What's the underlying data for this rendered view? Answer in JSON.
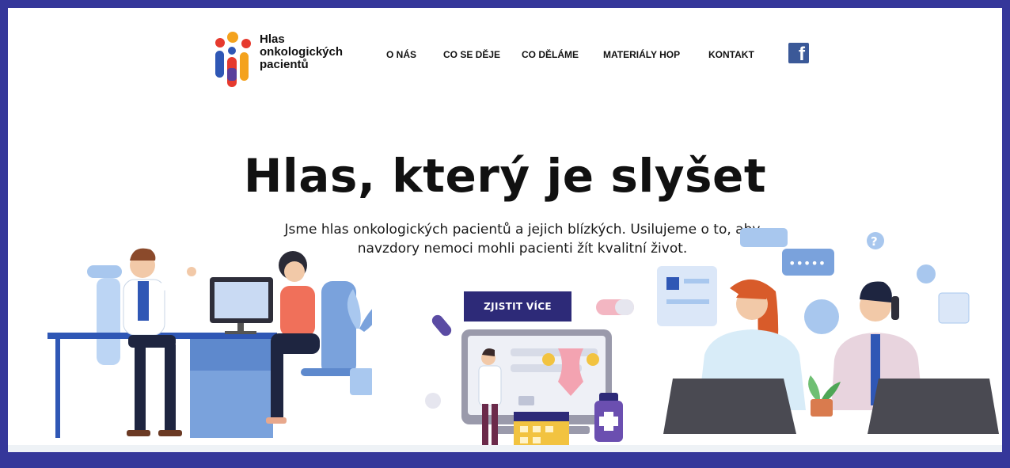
{
  "logo": {
    "line1": "Hlas",
    "line2": "onkologických",
    "line3": "pacientů"
  },
  "nav": {
    "items": [
      "O NÁS",
      "CO SE DĚJE",
      "CO DĚLÁME",
      "MATERIÁLY HOP",
      "KONTAKT"
    ]
  },
  "social": {
    "facebook_glyph": "f",
    "icon": "facebook-icon"
  },
  "hero": {
    "title": "Hlas, který je slyšet",
    "subtitle_line1": "Jsme hlas onkologických pacientů a jejich blízkých. Usilujeme o to, aby",
    "subtitle_line2": "navzdory nemoci mohli pacienti žít kvalitní život.",
    "cta_label": "ZJISTIT VÍCE"
  },
  "illustration": {
    "chat_dots": "•••••",
    "question_mark": "?"
  },
  "colors": {
    "frame": "#35379a",
    "cta": "#2d2a78",
    "facebook": "#3b5998",
    "logo_red": "#e63a2e",
    "logo_blue": "#2f57b5",
    "logo_orange": "#f4a21d",
    "logo_purple": "#5a3e9b"
  }
}
